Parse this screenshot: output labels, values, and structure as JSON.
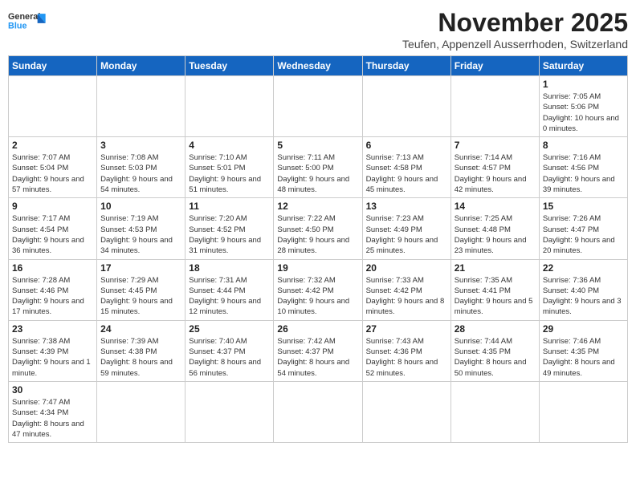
{
  "header": {
    "logo_general": "General",
    "logo_blue": "Blue",
    "month": "November 2025",
    "location": "Teufen, Appenzell Ausserrhoden, Switzerland"
  },
  "weekdays": [
    "Sunday",
    "Monday",
    "Tuesday",
    "Wednesday",
    "Thursday",
    "Friday",
    "Saturday"
  ],
  "weeks": [
    [
      {
        "day": "",
        "info": ""
      },
      {
        "day": "",
        "info": ""
      },
      {
        "day": "",
        "info": ""
      },
      {
        "day": "",
        "info": ""
      },
      {
        "day": "",
        "info": ""
      },
      {
        "day": "",
        "info": ""
      },
      {
        "day": "1",
        "info": "Sunrise: 7:05 AM\nSunset: 5:06 PM\nDaylight: 10 hours and 0 minutes."
      }
    ],
    [
      {
        "day": "2",
        "info": "Sunrise: 7:07 AM\nSunset: 5:04 PM\nDaylight: 9 hours and 57 minutes."
      },
      {
        "day": "3",
        "info": "Sunrise: 7:08 AM\nSunset: 5:03 PM\nDaylight: 9 hours and 54 minutes."
      },
      {
        "day": "4",
        "info": "Sunrise: 7:10 AM\nSunset: 5:01 PM\nDaylight: 9 hours and 51 minutes."
      },
      {
        "day": "5",
        "info": "Sunrise: 7:11 AM\nSunset: 5:00 PM\nDaylight: 9 hours and 48 minutes."
      },
      {
        "day": "6",
        "info": "Sunrise: 7:13 AM\nSunset: 4:58 PM\nDaylight: 9 hours and 45 minutes."
      },
      {
        "day": "7",
        "info": "Sunrise: 7:14 AM\nSunset: 4:57 PM\nDaylight: 9 hours and 42 minutes."
      },
      {
        "day": "8",
        "info": "Sunrise: 7:16 AM\nSunset: 4:56 PM\nDaylight: 9 hours and 39 minutes."
      }
    ],
    [
      {
        "day": "9",
        "info": "Sunrise: 7:17 AM\nSunset: 4:54 PM\nDaylight: 9 hours and 36 minutes."
      },
      {
        "day": "10",
        "info": "Sunrise: 7:19 AM\nSunset: 4:53 PM\nDaylight: 9 hours and 34 minutes."
      },
      {
        "day": "11",
        "info": "Sunrise: 7:20 AM\nSunset: 4:52 PM\nDaylight: 9 hours and 31 minutes."
      },
      {
        "day": "12",
        "info": "Sunrise: 7:22 AM\nSunset: 4:50 PM\nDaylight: 9 hours and 28 minutes."
      },
      {
        "day": "13",
        "info": "Sunrise: 7:23 AM\nSunset: 4:49 PM\nDaylight: 9 hours and 25 minutes."
      },
      {
        "day": "14",
        "info": "Sunrise: 7:25 AM\nSunset: 4:48 PM\nDaylight: 9 hours and 23 minutes."
      },
      {
        "day": "15",
        "info": "Sunrise: 7:26 AM\nSunset: 4:47 PM\nDaylight: 9 hours and 20 minutes."
      }
    ],
    [
      {
        "day": "16",
        "info": "Sunrise: 7:28 AM\nSunset: 4:46 PM\nDaylight: 9 hours and 17 minutes."
      },
      {
        "day": "17",
        "info": "Sunrise: 7:29 AM\nSunset: 4:45 PM\nDaylight: 9 hours and 15 minutes."
      },
      {
        "day": "18",
        "info": "Sunrise: 7:31 AM\nSunset: 4:44 PM\nDaylight: 9 hours and 12 minutes."
      },
      {
        "day": "19",
        "info": "Sunrise: 7:32 AM\nSunset: 4:42 PM\nDaylight: 9 hours and 10 minutes."
      },
      {
        "day": "20",
        "info": "Sunrise: 7:33 AM\nSunset: 4:42 PM\nDaylight: 9 hours and 8 minutes."
      },
      {
        "day": "21",
        "info": "Sunrise: 7:35 AM\nSunset: 4:41 PM\nDaylight: 9 hours and 5 minutes."
      },
      {
        "day": "22",
        "info": "Sunrise: 7:36 AM\nSunset: 4:40 PM\nDaylight: 9 hours and 3 minutes."
      }
    ],
    [
      {
        "day": "23",
        "info": "Sunrise: 7:38 AM\nSunset: 4:39 PM\nDaylight: 9 hours and 1 minute."
      },
      {
        "day": "24",
        "info": "Sunrise: 7:39 AM\nSunset: 4:38 PM\nDaylight: 8 hours and 59 minutes."
      },
      {
        "day": "25",
        "info": "Sunrise: 7:40 AM\nSunset: 4:37 PM\nDaylight: 8 hours and 56 minutes."
      },
      {
        "day": "26",
        "info": "Sunrise: 7:42 AM\nSunset: 4:37 PM\nDaylight: 8 hours and 54 minutes."
      },
      {
        "day": "27",
        "info": "Sunrise: 7:43 AM\nSunset: 4:36 PM\nDaylight: 8 hours and 52 minutes."
      },
      {
        "day": "28",
        "info": "Sunrise: 7:44 AM\nSunset: 4:35 PM\nDaylight: 8 hours and 50 minutes."
      },
      {
        "day": "29",
        "info": "Sunrise: 7:46 AM\nSunset: 4:35 PM\nDaylight: 8 hours and 49 minutes."
      }
    ],
    [
      {
        "day": "30",
        "info": "Sunrise: 7:47 AM\nSunset: 4:34 PM\nDaylight: 8 hours and 47 minutes."
      },
      {
        "day": "",
        "info": ""
      },
      {
        "day": "",
        "info": ""
      },
      {
        "day": "",
        "info": ""
      },
      {
        "day": "",
        "info": ""
      },
      {
        "day": "",
        "info": ""
      },
      {
        "day": "",
        "info": ""
      }
    ]
  ]
}
